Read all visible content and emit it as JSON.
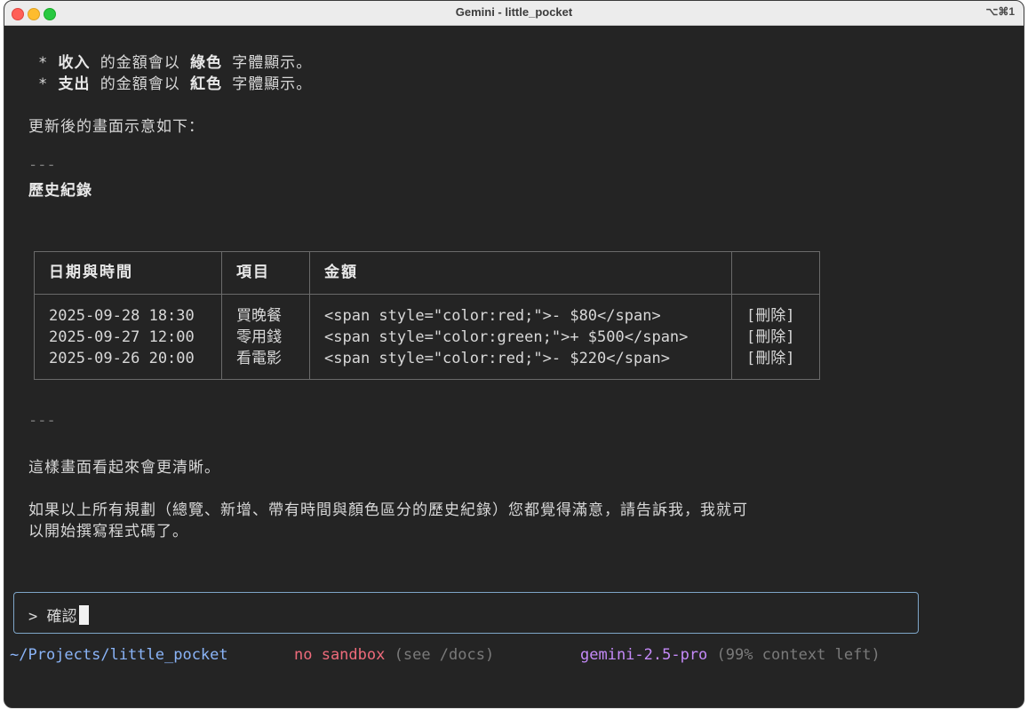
{
  "window": {
    "title": "Gemini - little_pocket",
    "shortcut": "⌥⌘1"
  },
  "message": {
    "bullet1": {
      "star": "*",
      "bold": "收入",
      "pre": "的金額會以",
      "color": "綠色",
      "post": "字體顯示。"
    },
    "bullet2": {
      "star": "*",
      "bold": "支出",
      "pre": "的金額會以",
      "color": "紅色",
      "post": "字體顯示。"
    },
    "intro": "更新後的畫面示意如下：",
    "rule1": "---",
    "heading": "歷史紀錄",
    "rule2": "---",
    "outro1": "這樣畫面看起來會更清晰。",
    "outro2": "如果以上所有規劃（總覽、新增、帶有時間與顏色區分的歷史紀錄）您都覺得滿意，請告訴我，我就可",
    "outro3": "以開始撰寫程式碼了。"
  },
  "table": {
    "headers": [
      "日期與時間",
      "項目",
      "金額",
      ""
    ],
    "rows": [
      {
        "datetime": "2025-09-28 18:30",
        "item": "買晚餐",
        "amount": "<span style=\"color:red;\">- $80</span>",
        "action": "[刪除]"
      },
      {
        "datetime": "2025-09-27 12:00",
        "item": "零用錢",
        "amount": "<span style=\"color:green;\">+ $500</span>",
        "action": "[刪除]"
      },
      {
        "datetime": "2025-09-26 20:00",
        "item": "看電影",
        "amount": "<span style=\"color:red;\">- $220</span>",
        "action": "[刪除]"
      }
    ]
  },
  "input": {
    "prompt_symbol": ">",
    "value": "確認"
  },
  "status": {
    "path": "~/Projects/little_pocket",
    "sandbox": "no sandbox",
    "sandbox_hint": "(see /docs)",
    "model": "gemini-2.5-pro",
    "context": "(99% context left)"
  },
  "colors": {
    "background": "#242424",
    "text": "#d8d8d8",
    "path": "#8ab4f8",
    "sandbox": "#ef6b7b",
    "model": "#c58af9",
    "input_border": "#7fa6c8"
  }
}
